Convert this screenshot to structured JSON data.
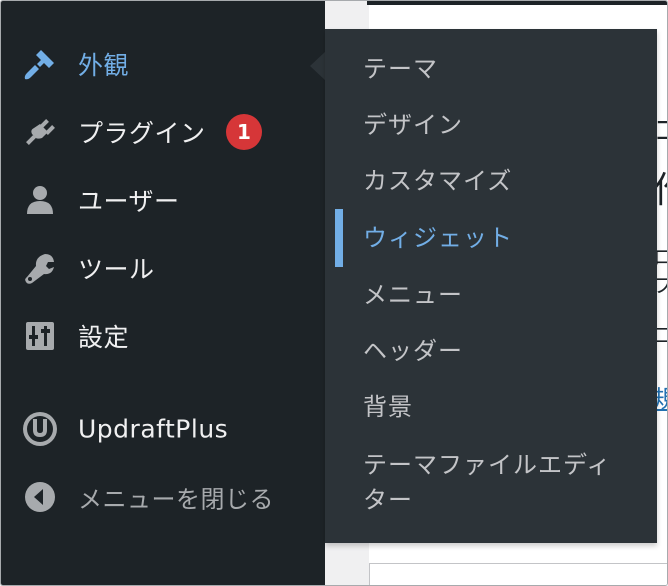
{
  "sidebar": {
    "items": [
      {
        "label": "外観",
        "icon": "paintbrush-icon",
        "active": true
      },
      {
        "label": "プラグイン",
        "icon": "plug-icon",
        "badge": "1"
      },
      {
        "label": "ユーザー",
        "icon": "user-icon"
      },
      {
        "label": "ツール",
        "icon": "wrench-icon"
      },
      {
        "label": "設定",
        "icon": "settings-sliders-icon"
      },
      {
        "label": "UpdraftPlus",
        "icon": "updraftplus-logo-icon"
      },
      {
        "label": "メニューを閉じる",
        "icon": "collapse-arrow-icon"
      }
    ]
  },
  "submenu": {
    "items": [
      {
        "label": "テーマ"
      },
      {
        "label": "デザイン"
      },
      {
        "label": "カスタマイズ"
      },
      {
        "label": "ウィジェット",
        "current": true
      },
      {
        "label": "メニュー"
      },
      {
        "label": "ヘッダー"
      },
      {
        "label": "背景"
      },
      {
        "label": "テーマファイルエディ",
        "label2": "ター"
      }
    ]
  },
  "colors": {
    "sidebar_bg": "#1d2327",
    "submenu_bg": "#2c3338",
    "accent": "#72aee6",
    "badge": "#d63638"
  }
}
